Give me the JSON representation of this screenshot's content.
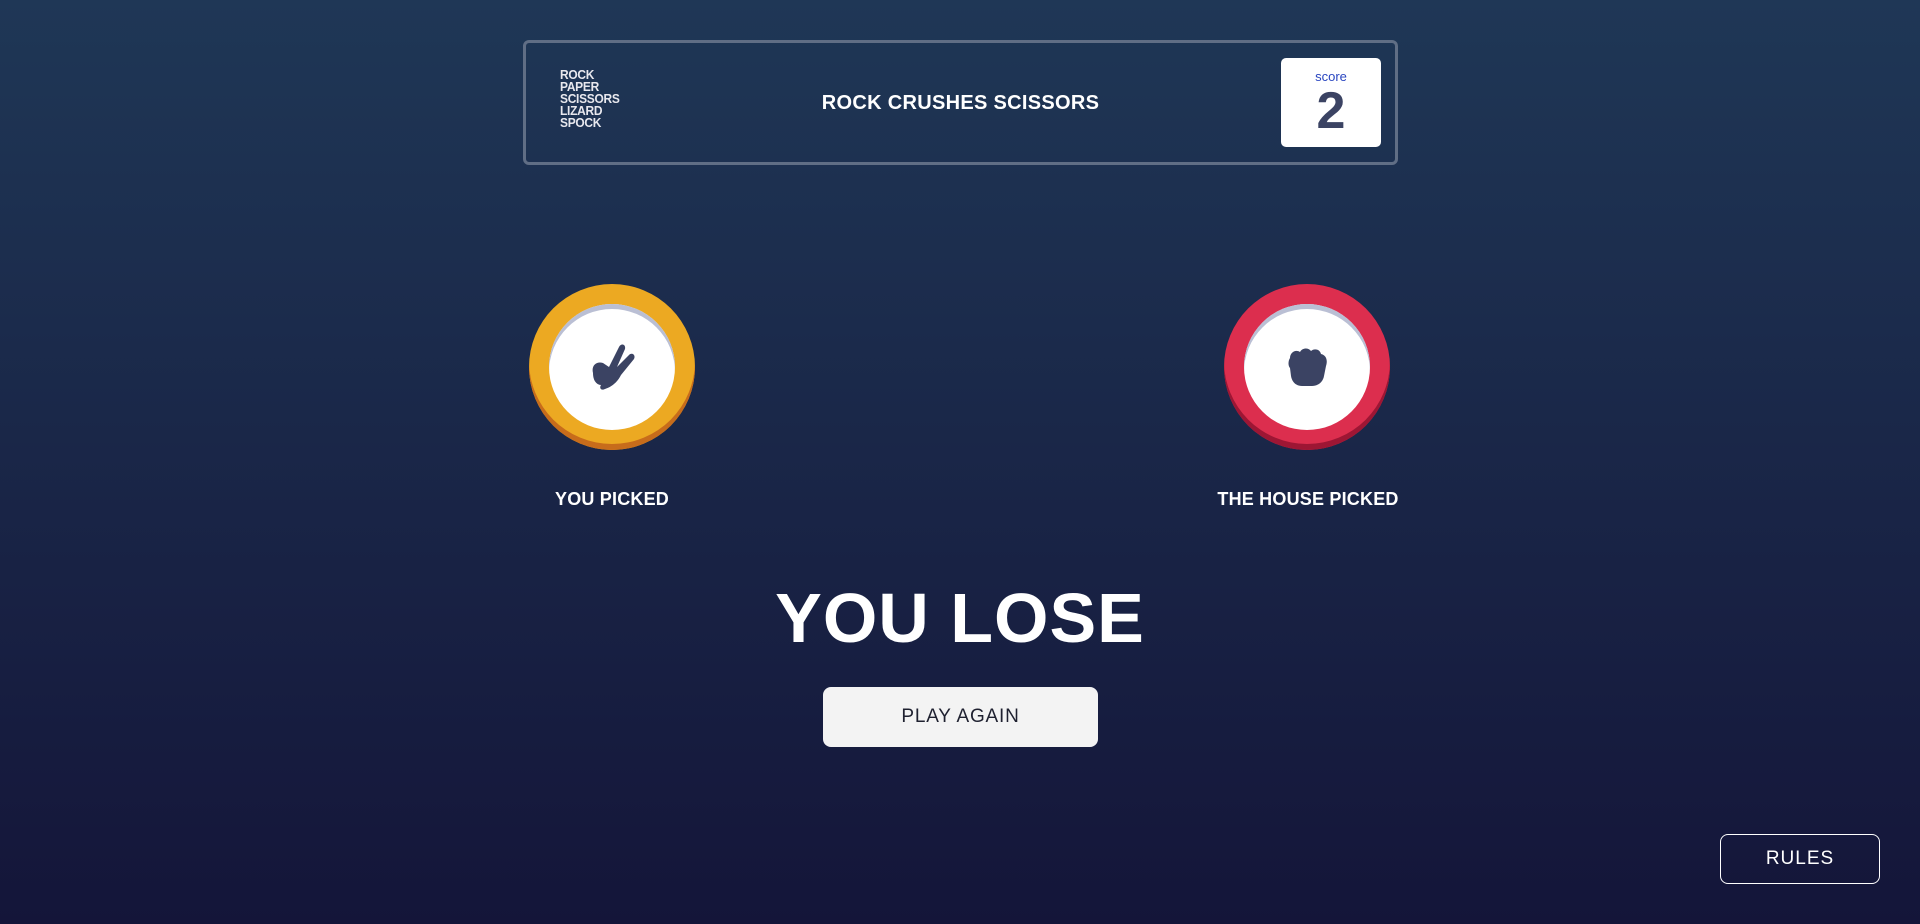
{
  "header": {
    "logo_lines": [
      "ROCK",
      "PAPER",
      "SCISSORS",
      "LIZARD",
      "SPOCK"
    ],
    "result_text": "ROCK CRUSHES SCISSORS",
    "score_label": "score",
    "score_value": "2"
  },
  "user_pick": {
    "choice": "scissors",
    "icon": "scissors-hand-icon",
    "ring_color": "#eca922",
    "label": "YOU PICKED"
  },
  "house_pick": {
    "choice": "rock",
    "icon": "rock-fist-icon",
    "ring_color": "#dc2e4e",
    "label": "THE HOUSE PICKED"
  },
  "outcome": "YOU LOSE",
  "play_again_label": "PLAY AGAIN",
  "rules_label": "RULES"
}
